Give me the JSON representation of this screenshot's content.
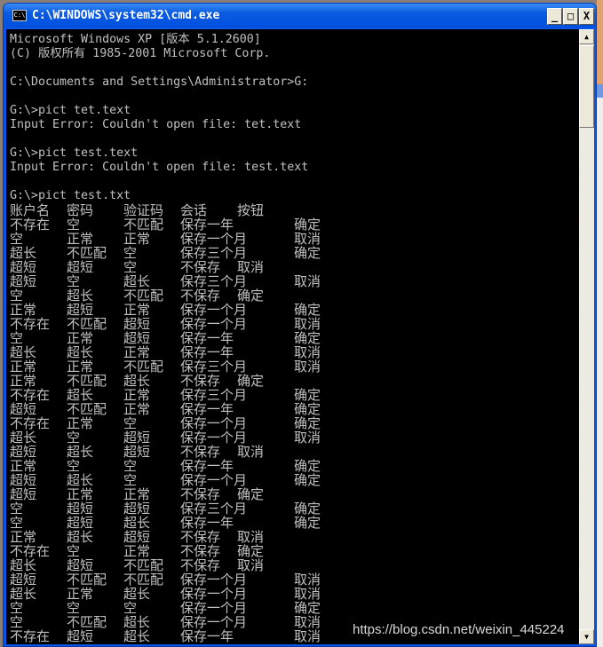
{
  "window": {
    "title": "C:\\WINDOWS\\system32\\cmd.exe",
    "icon": "cmd-icon",
    "icon_text": "C:\\",
    "minimize": "_",
    "maximize": "□",
    "close": "X"
  },
  "console": {
    "lines": [
      "Microsoft Windows XP [版本 5.1.2600]",
      "(C) 版权所有 1985-2001 Microsoft Corp.",
      "",
      "C:\\Documents and Settings\\Administrator>G:",
      "",
      "G:\\>pict tet.text",
      "Input Error: Couldn't open file: tet.text",
      "",
      "G:\\>pict test.text",
      "Input Error: Couldn't open file: test.text",
      "",
      "G:\\>pict test.txt"
    ],
    "table_header": [
      "账户名",
      "密码",
      "验证码",
      "会话",
      "按钮"
    ],
    "table_rows": [
      [
        "不存在",
        "空",
        "不匹配",
        "保存一年",
        "确定"
      ],
      [
        "空",
        "正常",
        "正常",
        "保存一个月",
        "取消"
      ],
      [
        "超长",
        "不匹配",
        "空",
        "保存三个月",
        "确定"
      ],
      [
        "超短",
        "超短",
        "空",
        "不保存",
        "取消"
      ],
      [
        "超短",
        "空",
        "超长",
        "保存三个月",
        "取消"
      ],
      [
        "空",
        "超长",
        "不匹配",
        "不保存",
        "确定"
      ],
      [
        "正常",
        "超短",
        "正常",
        "保存一个月",
        "确定"
      ],
      [
        "不存在",
        "不匹配",
        "超短",
        "保存一个月",
        "取消"
      ],
      [
        "空",
        "正常",
        "超短",
        "保存一年",
        "确定"
      ],
      [
        "超长",
        "超长",
        "正常",
        "保存一年",
        "取消"
      ],
      [
        "正常",
        "正常",
        "不匹配",
        "保存三个月",
        "取消"
      ],
      [
        "正常",
        "不匹配",
        "超长",
        "不保存",
        "确定"
      ],
      [
        "不存在",
        "超长",
        "正常",
        "保存三个月",
        "确定"
      ],
      [
        "超短",
        "不匹配",
        "正常",
        "保存一年",
        "确定"
      ],
      [
        "不存在",
        "正常",
        "空",
        "保存一个月",
        "确定"
      ],
      [
        "超长",
        "空",
        "超短",
        "保存一个月",
        "取消"
      ],
      [
        "超短",
        "超长",
        "超短",
        "不保存",
        "取消"
      ],
      [
        "正常",
        "空",
        "空",
        "保存一年",
        "确定"
      ],
      [
        "超短",
        "超长",
        "空",
        "保存一个月",
        "确定"
      ],
      [
        "超短",
        "正常",
        "正常",
        "不保存",
        "确定"
      ],
      [
        "空",
        "超短",
        "超短",
        "保存三个月",
        "确定"
      ],
      [
        "空",
        "超短",
        "超长",
        "保存一年",
        "确定"
      ],
      [
        "正常",
        "超长",
        "超短",
        "不保存",
        "取消"
      ],
      [
        "不存在",
        "空",
        "正常",
        "不保存",
        "确定"
      ],
      [
        "超长",
        "超短",
        "不匹配",
        "不保存",
        "取消"
      ],
      [
        "超短",
        "不匹配",
        "不匹配",
        "保存一个月",
        "取消"
      ],
      [
        "超长",
        "正常",
        "超长",
        "保存一个月",
        "取消"
      ],
      [
        "空",
        "空",
        "空",
        "保存一个月",
        "确定"
      ],
      [
        "空",
        "不匹配",
        "超长",
        "保存一个月",
        "取消"
      ],
      [
        "不存在",
        "超短",
        "超长",
        "保存一年",
        "取消"
      ]
    ]
  },
  "scrollbar": {
    "up": "▲",
    "down": "▼"
  },
  "watermark": "https://blog.csdn.net/weixin_445224"
}
